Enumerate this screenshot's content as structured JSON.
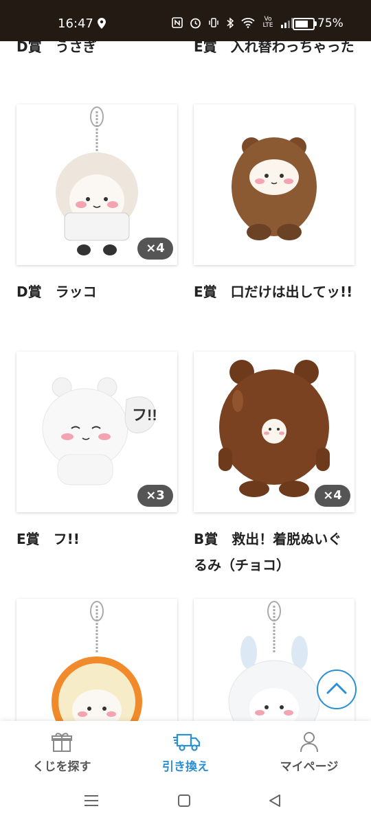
{
  "status_bar": {
    "time": "16:47",
    "battery": "75%",
    "battery_level": 0.75,
    "network": "Vo LTE"
  },
  "prizes": [
    {
      "title": "D賞　うさぎ"
    },
    {
      "title": "E賞　入れ替わっちゃった"
    },
    {
      "title": "D賞　ラッコ",
      "quantity": "×4"
    },
    {
      "title": "E賞　口だけは出してッ!!"
    },
    {
      "title": "E賞　フ!!",
      "quantity": "×3"
    },
    {
      "title": "B賞　救出！着脱ぬいぐるみ（チョコ）",
      "quantity": "×4"
    },
    {
      "title": ""
    },
    {
      "title": ""
    }
  ],
  "tabs": [
    {
      "label": "くじを探す",
      "icon": "gift-icon"
    },
    {
      "label": "引き換え",
      "icon": "truck-icon",
      "active": true
    },
    {
      "label": "マイページ",
      "icon": "person-icon"
    }
  ],
  "colors": {
    "accent": "#2a8fd4",
    "status_bar": "#231a14",
    "badge": "#555555"
  }
}
